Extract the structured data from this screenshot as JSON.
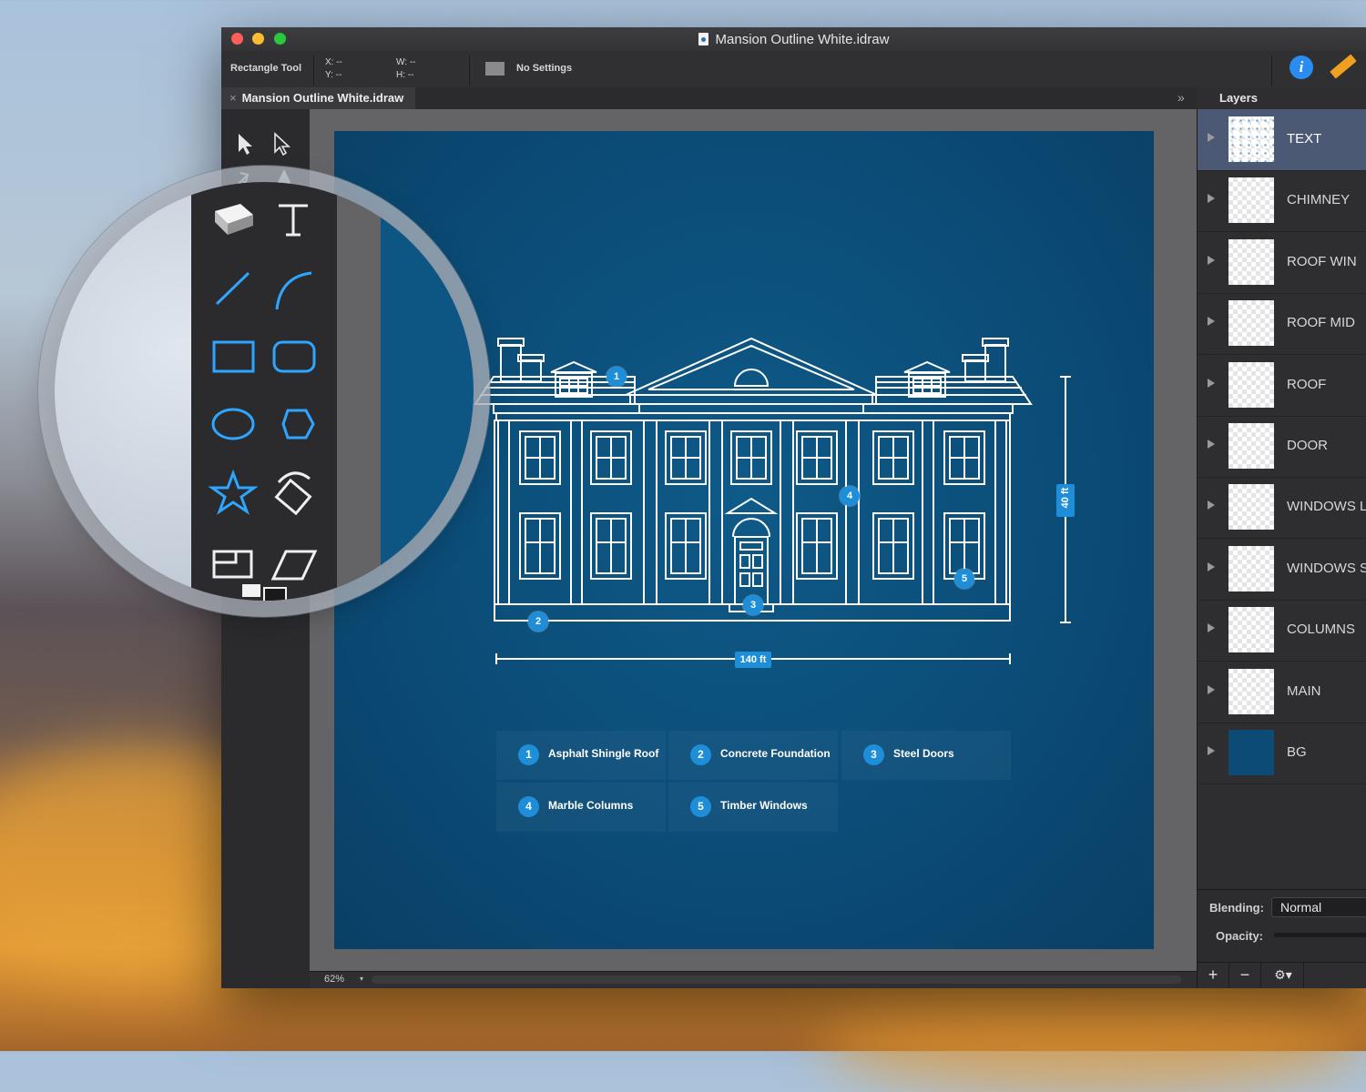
{
  "window": {
    "title": "Mansion Outline White.idraw"
  },
  "toolbar": {
    "tool_name": "Rectangle Tool",
    "x_label": "X: --",
    "y_label": "Y: --",
    "w_label": "W: --",
    "h_label": "H: --",
    "style_label": "No Settings",
    "info_icon": "i"
  },
  "tab": {
    "label": "Mansion Outline White.idraw",
    "close": "×",
    "collapse": "»"
  },
  "layers_panel": {
    "title": "Layers",
    "items": [
      {
        "name": "TEXT",
        "selected": true
      },
      {
        "name": "CHIMNEY"
      },
      {
        "name": "ROOF WIN"
      },
      {
        "name": "ROOF MID"
      },
      {
        "name": "ROOF"
      },
      {
        "name": "DOOR"
      },
      {
        "name": "WINDOWS L"
      },
      {
        "name": "WINDOWS S"
      },
      {
        "name": "COLUMNS"
      },
      {
        "name": "MAIN"
      },
      {
        "name": "BG"
      }
    ],
    "blending_label": "Blending:",
    "blending_value": "Normal",
    "opacity_label": "Opacity:",
    "add_button": "+",
    "remove_button": "−",
    "gear_button": "⚙▾"
  },
  "status": {
    "zoom": "62%",
    "zoom_caret": "▾"
  },
  "artwork": {
    "width_dim": "140 ft",
    "height_dim": "40 ft",
    "callouts": [
      "1",
      "2",
      "3",
      "4",
      "5"
    ],
    "legend": [
      {
        "num": "1",
        "text": "Asphalt Shingle Roof"
      },
      {
        "num": "2",
        "text": "Concrete Foundation"
      },
      {
        "num": "3",
        "text": "Steel Doors"
      },
      {
        "num": "4",
        "text": "Marble Columns"
      },
      {
        "num": "5",
        "text": "Timber Windows"
      }
    ]
  },
  "colors": {
    "accent": "#1e8ed8",
    "artboard": "#0b4b76",
    "selection": "#4c5974"
  }
}
